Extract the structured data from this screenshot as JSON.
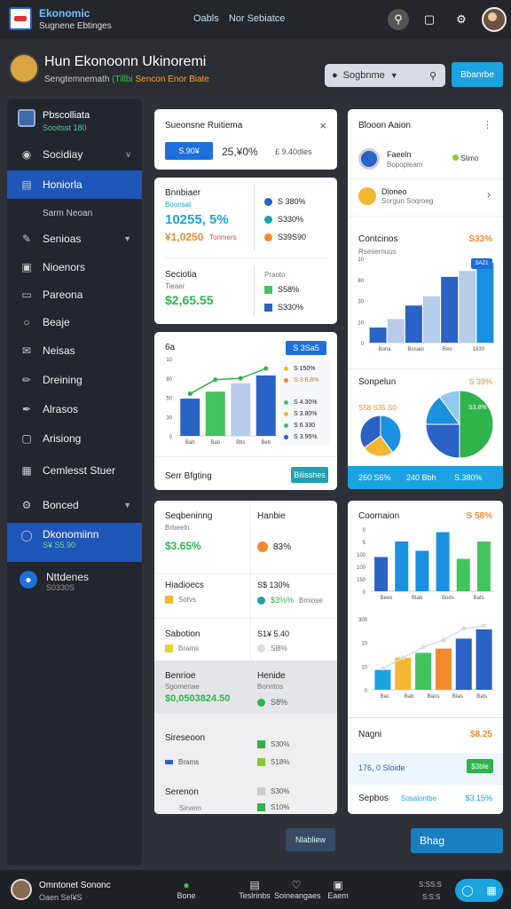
{
  "topbar": {
    "title": "Ekonomic",
    "subtitle": "Sugnene Ebtinges",
    "nav": [
      "Oabls",
      "Nor Sebiatce"
    ]
  },
  "header": {
    "title": "Hun Ekonoonn Ukinoremi",
    "subtitle_a": "Sengtemnemath",
    "subtitle_b": "(Tillbi",
    "subtitle_c": "Sencon Enor Biate",
    "search_placeholder": "Sogbnme",
    "button_label": "Bbanrbe"
  },
  "sidebar": {
    "header_title": "Pbscolliata",
    "header_sub": "Sooitsst 180",
    "items": [
      {
        "label": "Socidiay",
        "icon": "user-icon"
      },
      {
        "label": "Honiorla",
        "icon": "document-icon"
      },
      {
        "label": "Sarm Neoan",
        "icon": ""
      },
      {
        "label": "Senioas",
        "icon": "pen-icon"
      },
      {
        "label": "Nioenors",
        "icon": "monitor-icon"
      },
      {
        "label": "Pareona",
        "icon": "folder-icon"
      },
      {
        "label": "Beaje",
        "icon": "chat-icon"
      },
      {
        "label": "Neisas",
        "icon": "mail-icon"
      },
      {
        "label": "Dreining",
        "icon": "edit-icon"
      },
      {
        "label": "Alrasos",
        "icon": "wrench-icon"
      },
      {
        "label": "Arisiong",
        "icon": "screen-icon"
      },
      {
        "label": "Cemlesst Stuer",
        "icon": "calendar-icon"
      },
      {
        "label": "Bonced",
        "icon": "gear-icon"
      }
    ],
    "active_bottom": {
      "title": "Dkonomiinn",
      "sub": "S¥ S5.90"
    },
    "profile": {
      "title": "Nttdenes",
      "sub": "S0330S"
    }
  },
  "card_a": {
    "title": "Sueonsne Ruitiema",
    "button": "S.90¥",
    "value": "25,¥0%",
    "value2": "£ 9.40dles"
  },
  "card_b": {
    "label": "Bnnbiaer",
    "sub": "Boonsat",
    "big": "10255, 5%",
    "orange": "¥1,0250",
    "orange_sub": "Tonmers",
    "legend": [
      "S 380%",
      "S330%",
      "S39S90"
    ],
    "label2": "Seciotia",
    "sub2": "Tieaer",
    "big2": "$2,65.55",
    "legend2_head": "Praoto",
    "legend2": [
      "S58%",
      "S330%"
    ]
  },
  "card_c": {
    "title": "6a",
    "button": "S 3Sa5",
    "legend": [
      "S 150%",
      "S 3 6.8%",
      "S 4.30%",
      "S 3.80%",
      "S 6.330",
      "S 3.95%"
    ],
    "footer_label": "Serr Bfgting",
    "footer_button": "Bilisshes"
  },
  "card_d": {
    "title": "Blooon Aaion",
    "row1_title": "Faeeln",
    "row1_sub": "Bopopleam",
    "row1_value": "Slimo",
    "row2_title": "Dioneo",
    "row2_sub": "Sorgun Soqroeg",
    "chart_title": "Contcinos",
    "chart_value": "S33%",
    "chart_sub": "Rsesernuus",
    "badge": "SAZ1",
    "pie_title": "Sonpelun",
    "pie_value": "S 39%",
    "pie_sub": "S58 S35 S0",
    "pie_label": "S3.8%",
    "footer_left": "260 S6%",
    "footer_mid": "240 Bbh",
    "footer_right": "S.380%"
  },
  "card_e": {
    "r1_title": "Seqbeninng",
    "r1_sub": "Brbeeln",
    "r1_value": "$3.65%",
    "r1_title2": "Hanbie",
    "r1_value2": "83%",
    "r2_title": "Hiadioecs",
    "r2_sub": "Sotvs",
    "r2_title2": "S$ 130%",
    "r2_value2": "$3%%",
    "r2_sub2": "Bmiose",
    "r3_title": "Sabotion",
    "r3_sub": "Brams",
    "r3_title2": "S1¥ 5.40",
    "r3_sub2": "Sl8%",
    "r4_title": "Benrioe",
    "r4_sub": "Sgomenae",
    "r4_value": "$0,0503824.50",
    "r4_title2": "Henide",
    "r4_sub2": "Bonntos",
    "r4_value2": "S8%",
    "r5_title": "Sireseoon",
    "r5_sub": "Brams",
    "r5_value2": "S30%",
    "r5_value3": "S18%",
    "r6_title": "Serenon",
    "r6_sub": "Sirvem",
    "r6_value2": "S30%",
    "r6_value3": "S10%"
  },
  "card_f": {
    "title": "Coornaion",
    "value": "S 58%",
    "footer1_label": "Nagni",
    "footer1_value": "$8.25",
    "footer2_label": "176, 0 Sloide",
    "footer2_button": "$3ble",
    "footer3_label": "Sepbos",
    "footer3_mid": "Sosalontbe",
    "footer3_value": "$3.15%"
  },
  "buttons": {
    "left": "Nlabliew",
    "right": "Bhag"
  },
  "bottombar": {
    "title": "Omntonet Sononc",
    "sub": "Oaen Sel¥S",
    "nav": [
      "Bone",
      "Teslrinbs",
      "Soineangaes",
      "Eaem"
    ],
    "right_a": "S:SS:S",
    "right_b": "S:S:S"
  },
  "chart_data": [
    {
      "type": "bar",
      "title": "6a",
      "categories": [
        "Bah",
        "Bab",
        "Btis",
        "Beb"
      ],
      "values": [
        53,
        63,
        75,
        86
      ],
      "ylim": [
        0,
        110
      ],
      "yticks": [
        0,
        30,
        50,
        80,
        10
      ],
      "line_values": [
        60,
        80,
        82,
        96
      ],
      "colors": [
        "#2a62c6",
        "#43c35e",
        "#b7cdea",
        "#2a62c6"
      ]
    },
    {
      "type": "bar",
      "title": "Contcinos",
      "categories": [
        "Bona",
        "Bosaor",
        "Reo",
        "1830"
      ],
      "values": [
        18,
        28,
        44,
        55,
        78,
        85,
        95
      ],
      "ylim": [
        0,
        100
      ],
      "yticks": [
        0,
        10,
        30,
        80,
        10
      ],
      "colors": [
        "#2a62c6",
        "#b7cdea",
        "#2a62c6",
        "#b7cdea",
        "#2a62c6",
        "#b7cdea",
        "#1a90e0"
      ]
    },
    {
      "type": "pie",
      "title": "Sonpelun",
      "values": [
        40,
        25,
        35
      ],
      "colors": [
        "#1a90e0",
        "#f4b731",
        "#2a62c6"
      ]
    },
    {
      "type": "pie",
      "values": [
        50,
        25,
        15,
        10
      ],
      "colors": [
        "#30b34c",
        "#2a62c6",
        "#1a90e0",
        "#90c8f0"
      ]
    },
    {
      "type": "bar",
      "title": "Coornaion",
      "categories": [
        "Beos",
        "Btab",
        "Bods",
        "Bats"
      ],
      "values": [
        55,
        80,
        65,
        95,
        52,
        80
      ],
      "yticks": [
        0,
        150,
        100,
        100,
        5,
        0
      ],
      "colors": [
        "#2a62c6",
        "#1a90e0",
        "#1a90e0",
        "#1a90e0",
        "#43c35e",
        "#43c35e"
      ]
    },
    {
      "type": "bar",
      "categories": [
        "Bac",
        "Bab",
        "Baos",
        "Btas",
        "Bats"
      ],
      "values": [
        28,
        45,
        52,
        58,
        72,
        85
      ],
      "yticks": [
        0,
        10,
        10,
        300
      ],
      "line_values": [
        30,
        45,
        60,
        70,
        86,
        90
      ],
      "colors": [
        "#1aa3e0",
        "#f4b731",
        "#43c35e",
        "#f28b30",
        "#2a62c6",
        "#2a62c6"
      ]
    }
  ]
}
